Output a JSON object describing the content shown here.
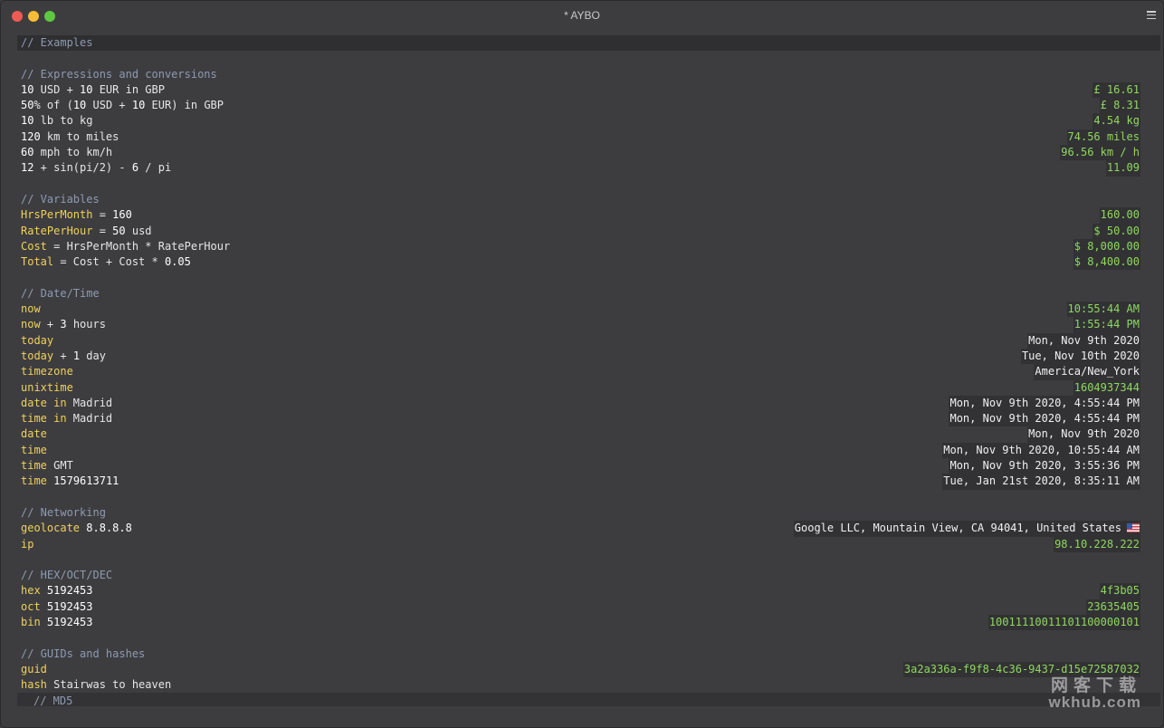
{
  "window": {
    "title": "* AYBO"
  },
  "lines": [
    {
      "type": "header",
      "comment": "// Examples"
    },
    {
      "type": "blank"
    },
    {
      "type": "comment",
      "comment": "// Expressions and conversions"
    },
    {
      "type": "expr",
      "segs": [
        [
          "num",
          "10"
        ],
        [
          "txt",
          " USD + "
        ],
        [
          "num",
          "10"
        ],
        [
          "txt",
          " EUR in GBP"
        ]
      ],
      "result": "£ 16.61",
      "rc": "green"
    },
    {
      "type": "expr",
      "segs": [
        [
          "num",
          "50"
        ],
        [
          "txt",
          "% of ("
        ],
        [
          "num",
          "10"
        ],
        [
          "txt",
          " USD + "
        ],
        [
          "num",
          "10"
        ],
        [
          "txt",
          " EUR) in GBP"
        ]
      ],
      "result": "£ 8.31",
      "rc": "green"
    },
    {
      "type": "expr",
      "segs": [
        [
          "num",
          "10"
        ],
        [
          "txt",
          " lb to kg"
        ]
      ],
      "result": "4.54 kg",
      "rc": "green"
    },
    {
      "type": "expr",
      "segs": [
        [
          "num",
          "120"
        ],
        [
          "txt",
          " km to miles"
        ]
      ],
      "result": "74.56 miles",
      "rc": "green"
    },
    {
      "type": "expr",
      "segs": [
        [
          "num",
          "60"
        ],
        [
          "txt",
          " mph to km/h"
        ]
      ],
      "result": "96.56 km / h",
      "rc": "green"
    },
    {
      "type": "expr",
      "segs": [
        [
          "num",
          "12"
        ],
        [
          "txt",
          " + sin(pi/2) - "
        ],
        [
          "num",
          "6"
        ],
        [
          "txt",
          " / pi"
        ]
      ],
      "result": "11.09",
      "rc": "green"
    },
    {
      "type": "blank"
    },
    {
      "type": "comment",
      "comment": "// Variables"
    },
    {
      "type": "expr",
      "segs": [
        [
          "kw",
          "HrsPerMonth"
        ],
        [
          "txt",
          " = "
        ],
        [
          "num",
          "160"
        ]
      ],
      "result": "160.00",
      "rc": "green"
    },
    {
      "type": "expr",
      "segs": [
        [
          "kw",
          "RatePerHour"
        ],
        [
          "txt",
          " = "
        ],
        [
          "num",
          "50"
        ],
        [
          "txt",
          " usd"
        ]
      ],
      "result": "$ 50.00",
      "rc": "green"
    },
    {
      "type": "expr",
      "segs": [
        [
          "kw",
          "Cost"
        ],
        [
          "txt",
          " = HrsPerMonth * RatePerHour"
        ]
      ],
      "result": "$ 8,000.00",
      "rc": "green"
    },
    {
      "type": "expr",
      "segs": [
        [
          "kw",
          "Total"
        ],
        [
          "txt",
          " = Cost + Cost * "
        ],
        [
          "num",
          "0.05"
        ]
      ],
      "result": "$ 8,400.00",
      "rc": "green"
    },
    {
      "type": "blank"
    },
    {
      "type": "comment",
      "comment": "// Date/Time"
    },
    {
      "type": "expr",
      "segs": [
        [
          "kw",
          "now"
        ]
      ],
      "result": "10:55:44 AM",
      "rc": "green"
    },
    {
      "type": "expr",
      "segs": [
        [
          "kw",
          "now"
        ],
        [
          "txt",
          " + "
        ],
        [
          "num",
          "3"
        ],
        [
          "txt",
          " hours"
        ]
      ],
      "result": "1:55:44 PM",
      "rc": "green"
    },
    {
      "type": "expr",
      "segs": [
        [
          "kw",
          "today"
        ]
      ],
      "result": "Mon, Nov 9th 2020",
      "rc": "white"
    },
    {
      "type": "expr",
      "segs": [
        [
          "kw",
          "today"
        ],
        [
          "txt",
          " + "
        ],
        [
          "num",
          "1"
        ],
        [
          "txt",
          " day"
        ]
      ],
      "result": "Tue, Nov 10th 2020",
      "rc": "white"
    },
    {
      "type": "expr",
      "segs": [
        [
          "kw",
          "timezone"
        ]
      ],
      "result": "America/New_York",
      "rc": "white"
    },
    {
      "type": "expr",
      "segs": [
        [
          "kw",
          "unixtime"
        ]
      ],
      "result": "1604937344",
      "rc": "green"
    },
    {
      "type": "expr",
      "segs": [
        [
          "kw",
          "date in"
        ],
        [
          "txt",
          " Madrid"
        ]
      ],
      "result": "Mon, Nov 9th 2020, 4:55:44 PM",
      "rc": "white"
    },
    {
      "type": "expr",
      "segs": [
        [
          "kw",
          "time in"
        ],
        [
          "txt",
          " Madrid"
        ]
      ],
      "result": "Mon, Nov 9th 2020, 4:55:44 PM",
      "rc": "white"
    },
    {
      "type": "expr",
      "segs": [
        [
          "kw",
          "date"
        ]
      ],
      "result": "Mon, Nov 9th 2020",
      "rc": "white"
    },
    {
      "type": "expr",
      "segs": [
        [
          "kw",
          "time"
        ]
      ],
      "result": "Mon, Nov 9th 2020, 10:55:44 AM",
      "rc": "white"
    },
    {
      "type": "expr",
      "segs": [
        [
          "kw",
          "time"
        ],
        [
          "txt",
          " GMT"
        ]
      ],
      "result": "Mon, Nov 9th 2020, 3:55:36 PM",
      "rc": "white"
    },
    {
      "type": "expr",
      "segs": [
        [
          "kw",
          "time"
        ],
        [
          "txt",
          " "
        ],
        [
          "num",
          "1579613711"
        ]
      ],
      "result": "Tue, Jan 21st 2020, 8:35:11 AM",
      "rc": "white"
    },
    {
      "type": "blank"
    },
    {
      "type": "comment",
      "comment": "// Networking"
    },
    {
      "type": "expr",
      "segs": [
        [
          "kw",
          "geolocate"
        ],
        [
          "txt",
          " "
        ],
        [
          "num",
          "8.8.8.8"
        ]
      ],
      "result": "Google LLC, Mountain View, CA 94041, United States",
      "rc": "white",
      "flag": "us-flag-icon"
    },
    {
      "type": "expr",
      "segs": [
        [
          "kw",
          "ip"
        ]
      ],
      "result": "98.10.228.222",
      "rc": "green"
    },
    {
      "type": "blank"
    },
    {
      "type": "comment",
      "comment": "// HEX/OCT/DEC"
    },
    {
      "type": "expr",
      "segs": [
        [
          "kw",
          "hex"
        ],
        [
          "txt",
          " "
        ],
        [
          "num",
          "5192453"
        ]
      ],
      "result": "4f3b05",
      "rc": "green"
    },
    {
      "type": "expr",
      "segs": [
        [
          "kw",
          "oct"
        ],
        [
          "txt",
          " "
        ],
        [
          "num",
          "5192453"
        ]
      ],
      "result": "23635405",
      "rc": "green"
    },
    {
      "type": "expr",
      "segs": [
        [
          "kw",
          "bin"
        ],
        [
          "txt",
          " "
        ],
        [
          "num",
          "5192453"
        ]
      ],
      "result": "10011110011101100000101",
      "rc": "green"
    },
    {
      "type": "blank"
    },
    {
      "type": "comment",
      "comment": "// GUIDs and hashes"
    },
    {
      "type": "expr",
      "segs": [
        [
          "kw",
          "guid"
        ]
      ],
      "result": "3a2a336a-f9f8-4c36-9437-d15e72587032",
      "rc": "green"
    },
    {
      "type": "expr",
      "segs": [
        [
          "kw",
          "hash"
        ],
        [
          "txt",
          " Stairwas to heaven"
        ]
      ],
      "result": "",
      "rc": "green"
    }
  ],
  "footer": {
    "comment": "// MD5"
  },
  "watermark": {
    "cn": "网客下载",
    "en": "wkhub.com"
  },
  "colors": {
    "keyword": "#f1d15b",
    "result_green": "#8fd85f",
    "comment": "#8e9ab0"
  }
}
